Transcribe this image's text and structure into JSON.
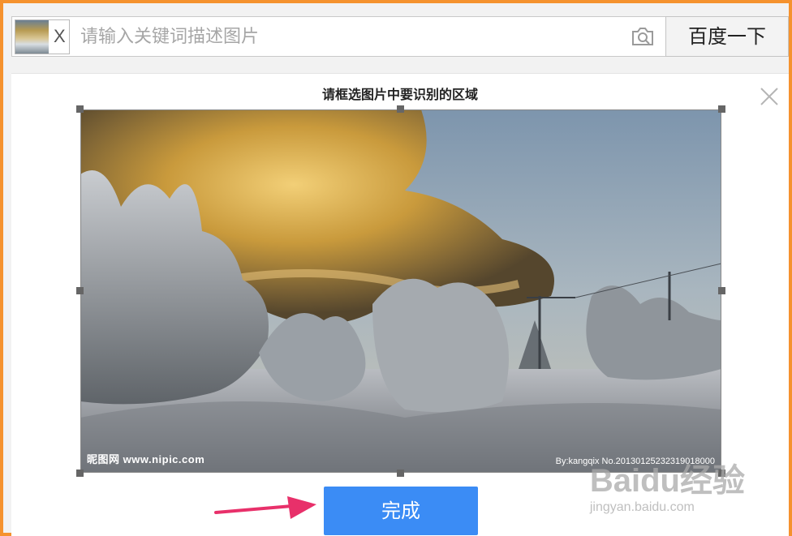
{
  "search": {
    "thumb_close": "X",
    "placeholder": "请输入关键词描述图片",
    "button_label": "百度一下"
  },
  "crop_dialog": {
    "title": "请框选图片中要识别的区域",
    "watermark_left": "昵图网 www.nipic.com",
    "watermark_right": "By:kangqix No.20130125232319018000",
    "done_label": "完成"
  },
  "page_watermark": {
    "brand": "Baidu经验",
    "url": "jingyan.baidu.com"
  },
  "colors": {
    "frame": "#f5922e",
    "done_button": "#3b8cf5",
    "arrow": "#e8306a"
  },
  "icons": [
    "camera-icon",
    "close-icon",
    "arrow-icon"
  ]
}
